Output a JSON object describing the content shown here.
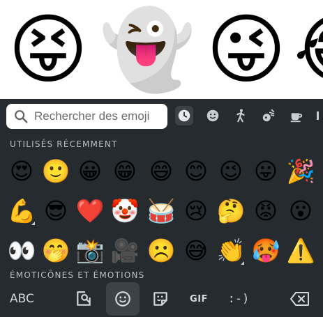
{
  "suggestions": [
    {
      "glyph": "😝",
      "name": "face-tongue-squint-emoji"
    },
    {
      "glyph": "👻",
      "name": "ghost-emoji"
    },
    {
      "glyph": "😜",
      "name": "face-tongue-wink-emoji"
    },
    {
      "glyph": "😂",
      "name": "face-tears-partial-emoji"
    }
  ],
  "search": {
    "placeholder": "Rechercher des emoji"
  },
  "categories": [
    {
      "name": "recent-clock-icon",
      "active": true
    },
    {
      "name": "smiley-category-icon",
      "active": false
    },
    {
      "name": "person-category-icon",
      "active": false
    },
    {
      "name": "activity-category-icon",
      "active": false
    },
    {
      "name": "food-category-icon",
      "active": false
    }
  ],
  "sections": {
    "recent_label": "UTILISÉS RÉCEMMENT",
    "emotions_label": "ÉMOTICÔNES ET ÉMOTIONS"
  },
  "recent_rows": [
    [
      "😍",
      "🙂",
      "😀",
      "😁",
      "😄",
      "😊",
      "😉",
      "😛",
      "🎉"
    ],
    [
      "💪",
      "😎",
      "❤️",
      "🤡",
      "🥁",
      "😢",
      "🤔",
      "😡",
      "😮"
    ],
    [
      "👀",
      "🤭",
      "📸",
      "🎥",
      "☹️",
      "😅",
      "👏",
      "🥵",
      "⚠️"
    ]
  ],
  "has_variants": {
    "1": [
      0
    ],
    "2": [
      6
    ]
  },
  "bottom": {
    "abc_label": "ABC",
    "gif_label": "GIF",
    "emoticon_label": ":-)"
  }
}
